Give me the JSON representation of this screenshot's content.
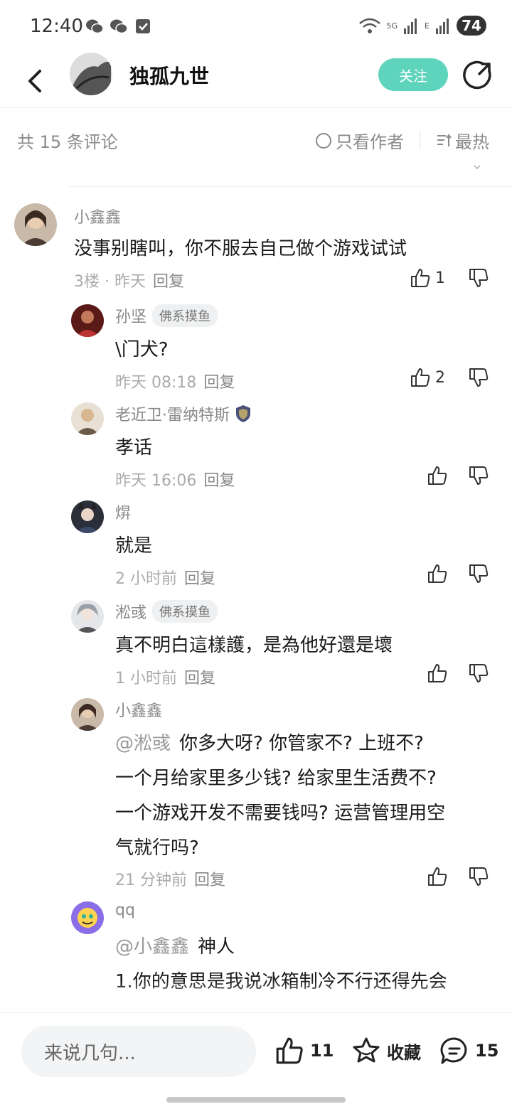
{
  "status_bar": {
    "time": "12:40",
    "battery": "74",
    "net1": "5G",
    "net2": "E"
  },
  "header": {
    "title": "独孤九世",
    "follow_label": "关注"
  },
  "filters": {
    "count_label": "共 15 条评论",
    "author_only_label": "只看作者",
    "sort_label": "最热"
  },
  "comments": [
    {
      "user": "小鑫鑫",
      "text": "没事别瞎叫，你不服去自己做个游戏试试",
      "floor": "3楼 · 昨天",
      "reply": "回复",
      "likes": "1"
    },
    {
      "user": "孙坚",
      "badge": "佛系摸鱼",
      "text": "\\门犬?",
      "time": "昨天 08:18",
      "reply": "回复",
      "likes": "2"
    },
    {
      "user": "老近卫·雷纳特斯",
      "text": "孝话",
      "time": "昨天 16:06",
      "reply": "回复"
    },
    {
      "user": "焺",
      "text": "就是",
      "time": "2 小时前",
      "reply": "回复"
    },
    {
      "user": "淞彧",
      "badge": "佛系摸鱼",
      "text": "真不明白這樣護，是為他好還是壞",
      "time": "1 小时前",
      "reply": "回复"
    },
    {
      "user": "小鑫鑫",
      "mention": "@淞彧",
      "text_lines": [
        "你多大呀? 你管家不? 上班不?",
        "一个月给家里多少钱? 给家里生活费不?",
        "一个游戏开发不需要钱吗? 运营管理用空",
        "气就行吗?"
      ],
      "time": "21 分钟前",
      "reply": "回复"
    },
    {
      "user": "qq",
      "mention": "@小鑫鑫",
      "text_lines": [
        "神人",
        "1.你的意思是我说冰箱制冷不行还得先会"
      ],
      "time": "",
      "reply": ""
    }
  ],
  "bottom": {
    "input_placeholder": "来说几句...",
    "like_count": "11",
    "fav_label": "收藏",
    "comment_count": "15"
  }
}
